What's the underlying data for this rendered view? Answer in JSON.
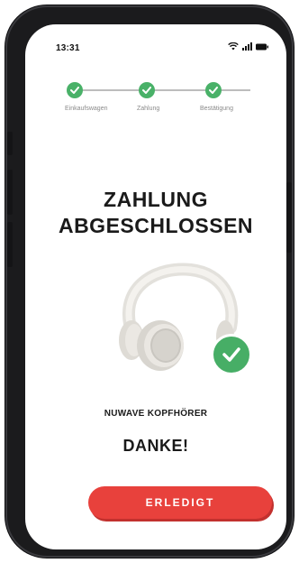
{
  "status_bar": {
    "time": "13:31"
  },
  "stepper": {
    "steps": [
      {
        "label": "Einkaufswagen",
        "done": true
      },
      {
        "label": "Zahlung",
        "done": true
      },
      {
        "label": "Bestätigung",
        "done": true
      }
    ],
    "accent": "#49b168"
  },
  "title": {
    "line1": "ZAHLUNG",
    "line2": "ABGESCHLOSSEN"
  },
  "product": {
    "name": "NUWAVE KOPFHÖRER"
  },
  "thanks": "DANKE!",
  "done_button": {
    "label": "ERLEDIGT",
    "color": "#e8413c"
  }
}
